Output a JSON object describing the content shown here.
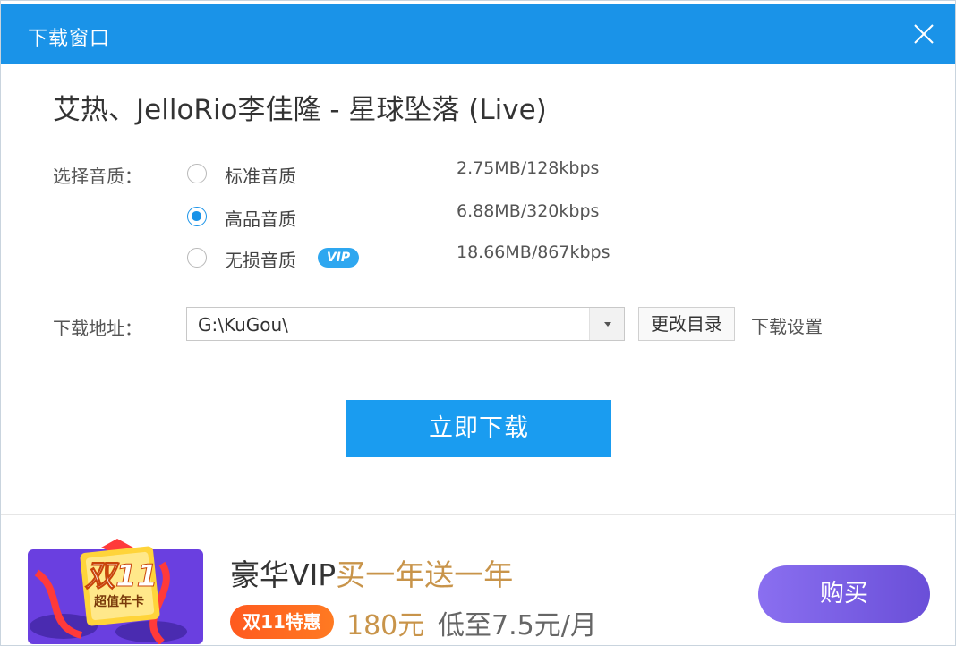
{
  "window": {
    "title": "下载窗口"
  },
  "song": {
    "title": "艾热、JelloRio李佳隆 - 星球坠落 (Live)"
  },
  "quality": {
    "label": "选择音质：",
    "options": [
      {
        "name": "标准音质",
        "size": "2.75MB/128kbps",
        "selected": false,
        "badge": ""
      },
      {
        "name": "高品音质",
        "size": "6.88MB/320kbps",
        "selected": true,
        "badge": ""
      },
      {
        "name": "无损音质",
        "size": "18.66MB/867kbps",
        "selected": false,
        "badge": "VIP"
      }
    ]
  },
  "download_path": {
    "label": "下载地址：",
    "value": "G:\\KuGou\\",
    "change_dir_label": "更改目录",
    "settings_label": "下载设置"
  },
  "actions": {
    "download_label": "立即下载"
  },
  "promo": {
    "art_text_line1": "双11",
    "art_text_line2": "超值年卡",
    "title_part1": "豪华VIP",
    "title_part2": "买一年送一年",
    "badge": "双11特惠",
    "price": "180元",
    "sub": "低至7.5元/月",
    "buy_label": "购买"
  },
  "colors": {
    "accent": "#1a93e8",
    "promo_gold": "#c8944a",
    "promo_orange": "#ff5a1f",
    "buy_purple": "#7a5fe4"
  }
}
